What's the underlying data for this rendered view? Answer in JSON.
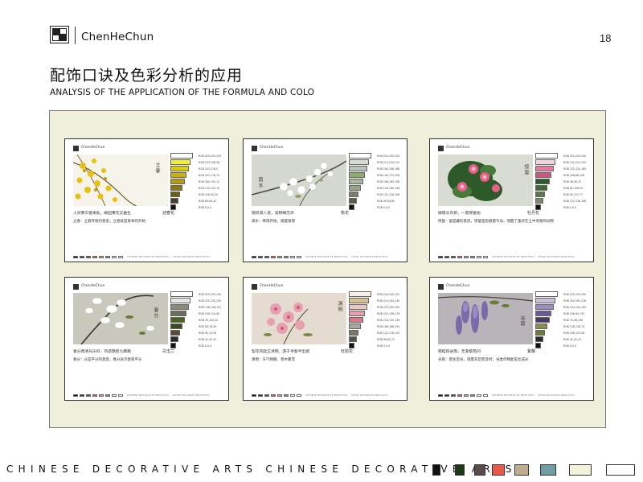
{
  "header": {
    "brand": "ChenHeChun",
    "page_number": "18",
    "title_cn": "配饰口诀及色彩分析的应用",
    "title_en": "ANALYSIS OF THE APPLICATION OF THE FORMULA AND COLO"
  },
  "cards": [
    {
      "brand": "ChenHeChun",
      "poem": "立春",
      "flower": "迎春花",
      "caption1": "人间要识春来处，故园黄花又垂生",
      "caption2": "立春：立春开始的意思，立春就是春季的开始",
      "swatches": [
        "#ffffff",
        "#f2ee3a",
        "#d8cc0e",
        "#c9b00c",
        "#b49a0c",
        "#8a780e",
        "#6a5e14",
        "#46402a",
        "#111111"
      ],
      "codes": [
        "RGB 255,255,255",
        "RGB 253,238,58",
        "RGB 243,218,0",
        "RGB 201,176,12",
        "RGB 180,154,12",
        "RGB 139,120,14",
        "RGB 106,94,20",
        "RGB 69,64,42",
        "RGB 0,0,0"
      ]
    },
    {
      "brand": "ChenHeChun",
      "poem": "雨水",
      "flower": "桃花",
      "caption1": "随风潜入夜，润物细无声",
      "caption2": "雨水：降雨开始，雨量渐增",
      "swatches": [
        "#ffffff",
        "#d6dcd4",
        "#b8c4bc",
        "#8cac6a",
        "#a8b49c",
        "#9aa08a",
        "#7a7e6a",
        "#5a5e50",
        "#111111"
      ],
      "codes": [
        "RGB 255,255,255",
        "RGB 214,220,212",
        "RGB 184,196,188",
        "RGB 140,172,106",
        "RGB 168,180,156",
        "RGB 154,160,138",
        "RGB 122,126,106",
        "RGB 90,94,80",
        "RGB 0,0,0"
      ]
    },
    {
      "brand": "ChenHeChun",
      "poem": "惊蛰",
      "flower": "牡丹花",
      "caption1": "微雨众卉新，一雷惊蛰始",
      "caption2": "惊蛰：蛰是藏的意思，惊蛰是指春雷乍动，惊醒了蛰伏在土中冬眠的动物",
      "swatches": [
        "#ffffff",
        "#f2d4dc",
        "#e87ca0",
        "#d05680",
        "#2e5a2a",
        "#3e6a32",
        "#5a7a48",
        "#7a8a6a",
        "#111111"
      ],
      "codes": [
        "RGB 255,255,255",
        "RGB 242,212,220",
        "RGB 232,124,160",
        "RGB 208,86,128",
        "RGB 46,90,42",
        "RGB 62,106,50",
        "RGB 90,122,72",
        "RGB 122,138,106",
        "RGB 0,0,0"
      ]
    },
    {
      "brand": "ChenHeChun",
      "poem": "春分",
      "flower": "白玉兰",
      "caption1": "春分雨清光乐好，风适飘摇九畹路",
      "caption2": "春分：分是平分的意思，春分表示昼夜平分",
      "swatches": [
        "#ffffff",
        "#e6e6e6",
        "#8a8a7a",
        "#6a6e5a",
        "#4c6422",
        "#3a4c1a",
        "#5a4a3a",
        "#2a2a2a",
        "#111111"
      ],
      "codes": [
        "RGB 255,255,255",
        "RGB 230,230,230",
        "RGB 138,138,122",
        "RGB 106,110,90",
        "RGB 76,100,34",
        "RGB 58,76,26",
        "RGB 90,74,58",
        "RGB 42,42,42",
        "RGB 0,0,0"
      ]
    },
    {
      "brand": "ChenHeChun",
      "poem": "清明",
      "flower": "杜鹃花",
      "caption1": "梨花风起正清明，游子寻春半出城",
      "caption2": "清明：天气晴朗，草木繁茂",
      "swatches": [
        "#f4f0e8",
        "#d6c28c",
        "#e8c8c0",
        "#e89cb0",
        "#d8788a",
        "#a8a89a",
        "#7a7668",
        "#5a5248",
        "#111111"
      ],
      "codes": [
        "RGB 244,240,232",
        "RGB 214,194,140",
        "RGB 232,200,192",
        "RGB 232,156,176",
        "RGB 216,120,138",
        "RGB 168,168,154",
        "RGB 122,118,104",
        "RGB 90,82,72",
        "RGB 0,0,0"
      ]
    },
    {
      "brand": "ChenHeChun",
      "poem": "谷雨",
      "flower": "紫藤",
      "caption1": "萌畦四谷雨，无渐蔡苑间",
      "caption2": "谷雨：雨生百谷，雨量充足而及时，谷类作物能茁壮成长",
      "swatches": [
        "#ffffff",
        "#c8c0d8",
        "#9a8cc0",
        "#6a5a98",
        "#4a3a6a",
        "#8a8a4a",
        "#6a7a3a",
        "#2a2a2a",
        "#111111"
      ],
      "codes": [
        "RGB 255,255,255",
        "RGB 200,192,216",
        "RGB 154,140,192",
        "RGB 106,90,152",
        "RGB 74,58,106",
        "RGB 138,138,74",
        "RGB 106,122,58",
        "RGB 42,42,42",
        "RGB 0,0,0"
      ]
    }
  ],
  "card_footer_text": "CHINESE DECORATIVE BEAUTIFUL · CHINA DECORATE BEAUTIFUL",
  "card_footer_colors": [
    "#111111",
    "#2a3a1a",
    "#5a4a4a",
    "#e8544a",
    "#b8a88a",
    "#6a9aa0",
    "#f2f2dc",
    "#ffffff"
  ],
  "footer": {
    "text": "CHINESE DECORATIVE ARTS CHINESE DECORATIVE ARTS",
    "swatches": [
      "#111111",
      "#1e3a14",
      "#5a4a4a",
      "#e85a48",
      "#c0ac8e",
      "#6e9ea4",
      "#f2f2dc",
      "#ffffff"
    ]
  }
}
